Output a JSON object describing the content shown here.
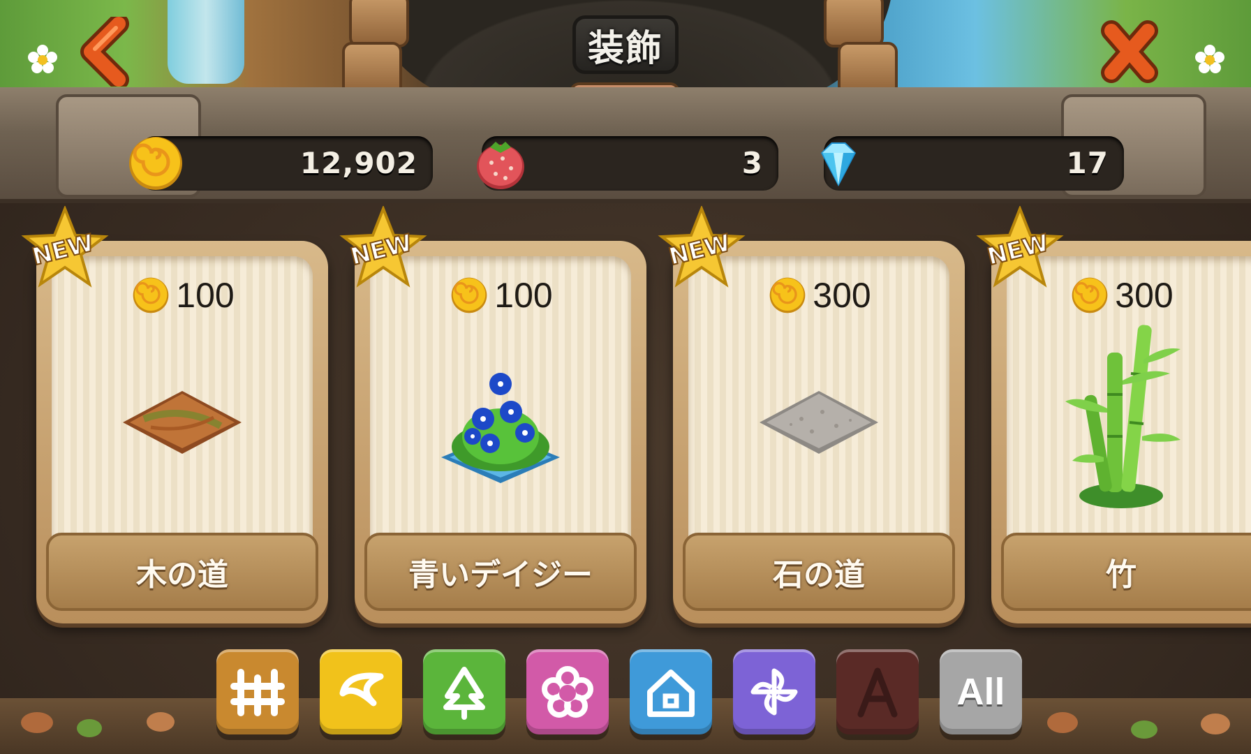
{
  "header": {
    "title": "装飾",
    "back_icon": "chevron-left-icon",
    "close_icon": "close-icon"
  },
  "currencies": [
    {
      "name": "coins",
      "icon": "coin-icon",
      "amount": "12,902"
    },
    {
      "name": "strawberries",
      "icon": "strawberry-icon",
      "amount": "3"
    },
    {
      "name": "diamonds",
      "icon": "diamond-icon",
      "amount": "17"
    }
  ],
  "items": [
    {
      "badge": "NEW",
      "price": "100",
      "price_currency": "coin",
      "name": "木の道",
      "art": "wood-path"
    },
    {
      "badge": "NEW",
      "price": "100",
      "price_currency": "coin",
      "name": "青いデイジー",
      "art": "blue-daisy"
    },
    {
      "badge": "NEW",
      "price": "300",
      "price_currency": "coin",
      "name": "石の道",
      "art": "stone-path"
    },
    {
      "badge": "NEW",
      "price": "300",
      "price_currency": "coin",
      "name": "竹",
      "art": "bamboo"
    }
  ],
  "categories": [
    {
      "icon": "fence-icon",
      "color": "#c9892f"
    },
    {
      "icon": "moon-icon",
      "color": "#f1c21b"
    },
    {
      "icon": "tree-icon",
      "color": "#5bb53b"
    },
    {
      "icon": "flower-icon",
      "color": "#d25aa8"
    },
    {
      "icon": "house-icon",
      "color": "#3f9ad9"
    },
    {
      "icon": "pinwheel-icon",
      "color": "#7d63d6"
    },
    {
      "icon": "letter-a-icon",
      "color": "#5a2a26"
    },
    {
      "icon": "all-icon",
      "label": "All",
      "color": "#a6a6a6"
    }
  ],
  "colors": {
    "accent_orange": "#e65a1e",
    "coin_gold": "#f7c21a",
    "card_cream": "#f6ecd8",
    "card_frame": "#c7a26d"
  }
}
